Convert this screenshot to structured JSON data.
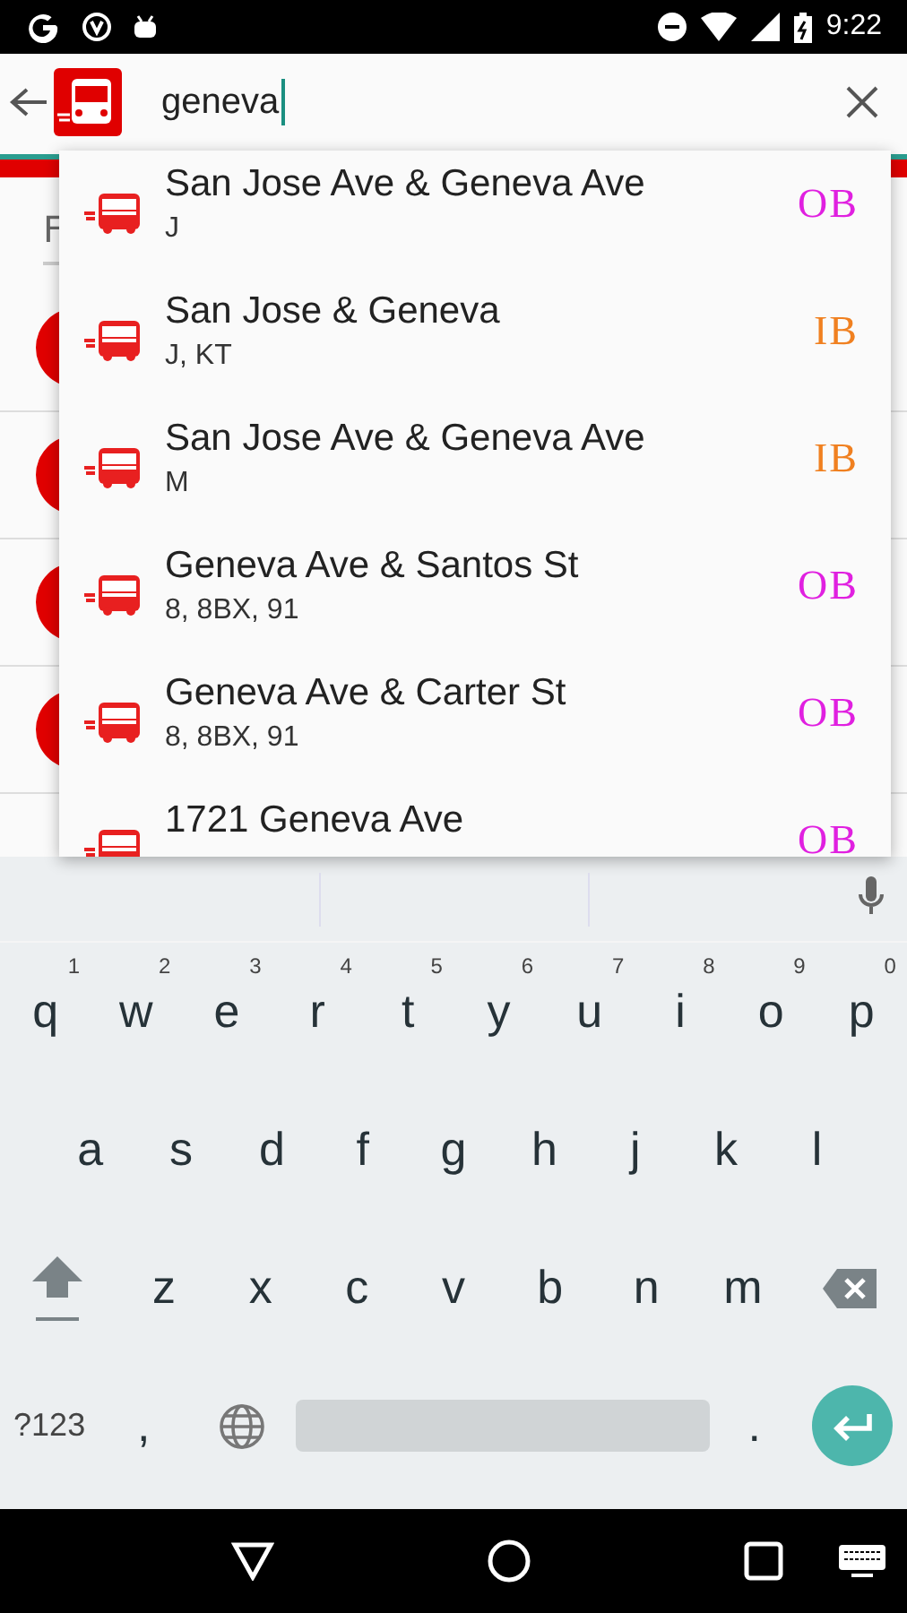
{
  "status_bar": {
    "time": "9:22"
  },
  "search": {
    "value": "geneva"
  },
  "background": {
    "partial_label": "F"
  },
  "suggestions": [
    {
      "name": "San Jose Ave & Geneva Ave",
      "routes": "J",
      "direction": "OB",
      "color": "#e020e0"
    },
    {
      "name": "San Jose & Geneva",
      "routes": "J, KT",
      "direction": "IB",
      "color": "#f08020"
    },
    {
      "name": "San Jose Ave & Geneva Ave",
      "routes": "M",
      "direction": "IB",
      "color": "#f08020"
    },
    {
      "name": "Geneva Ave & Santos St",
      "routes": "8, 8BX, 91",
      "direction": "OB",
      "color": "#e020e0"
    },
    {
      "name": "Geneva Ave & Carter St",
      "routes": "8, 8BX, 91",
      "direction": "OB",
      "color": "#e020e0"
    },
    {
      "name": "1721 Geneva Ave",
      "direction": "OB",
      "color": "#e020e0"
    }
  ],
  "keyboard": {
    "rows": [
      [
        {
          "kind": "key",
          "label": "q",
          "hint": "1"
        },
        {
          "kind": "key",
          "label": "w",
          "hint": "2"
        },
        {
          "kind": "key",
          "label": "e",
          "hint": "3"
        },
        {
          "kind": "key",
          "label": "r",
          "hint": "4"
        },
        {
          "kind": "key",
          "label": "t",
          "hint": "5"
        },
        {
          "kind": "key",
          "label": "y",
          "hint": "6"
        },
        {
          "kind": "key",
          "label": "u",
          "hint": "7"
        },
        {
          "kind": "key",
          "label": "i",
          "hint": "8"
        },
        {
          "kind": "key",
          "label": "o",
          "hint": "9"
        },
        {
          "kind": "key",
          "label": "p",
          "hint": "0"
        }
      ],
      [
        {
          "kind": "key",
          "label": "a"
        },
        {
          "kind": "key",
          "label": "s"
        },
        {
          "kind": "key",
          "label": "d"
        },
        {
          "kind": "key",
          "label": "f"
        },
        {
          "kind": "key",
          "label": "g"
        },
        {
          "kind": "key",
          "label": "h"
        },
        {
          "kind": "key",
          "label": "j"
        },
        {
          "kind": "key",
          "label": "k"
        },
        {
          "kind": "key",
          "label": "l"
        }
      ],
      [
        {
          "kind": "shift"
        },
        {
          "kind": "key",
          "label": "z"
        },
        {
          "kind": "key",
          "label": "x"
        },
        {
          "kind": "key",
          "label": "c"
        },
        {
          "kind": "key",
          "label": "v"
        },
        {
          "kind": "key",
          "label": "b"
        },
        {
          "kind": "key",
          "label": "n"
        },
        {
          "kind": "key",
          "label": "m"
        },
        {
          "kind": "backspace"
        }
      ],
      [
        {
          "kind": "symbols",
          "label": "?123"
        },
        {
          "kind": "key",
          "label": ","
        },
        {
          "kind": "globe"
        },
        {
          "kind": "space"
        },
        {
          "kind": "key",
          "label": "."
        },
        {
          "kind": "enter"
        }
      ]
    ]
  }
}
